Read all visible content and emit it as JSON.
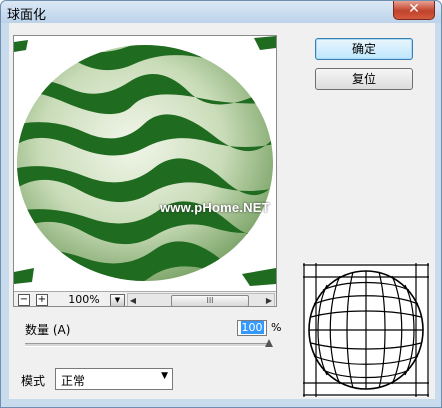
{
  "window": {
    "title": "球面化",
    "close_glyph": "✕"
  },
  "preview": {
    "watermark": "www.pHome.NET",
    "zoom": {
      "minus": "−",
      "plus": "+",
      "value": "100%"
    },
    "scroll_grip": "III"
  },
  "buttons": {
    "ok": "确定",
    "reset": "复位"
  },
  "amount": {
    "label": "数量 (A)",
    "value": "100",
    "unit": "%",
    "slider_fraction": 1.0
  },
  "mode": {
    "label": "模式",
    "value": "正常"
  },
  "colors": {
    "stripe": "#1f6b1f",
    "rind": "#cfe3c2"
  }
}
